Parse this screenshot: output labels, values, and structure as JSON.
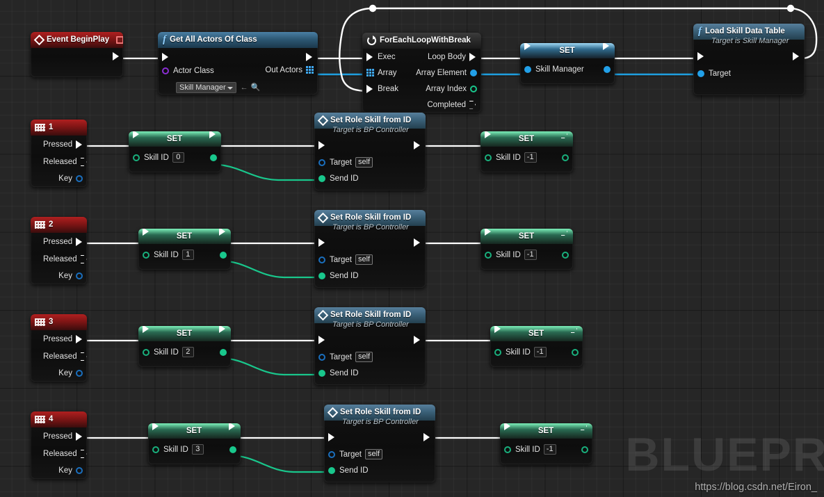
{
  "graph": {
    "title": "Blueprint Event Graph",
    "background_color": "#262626",
    "watermark": "BLUEPR",
    "url": "https://blog.csdn.net/Eiron_"
  },
  "nodes": {
    "event_begin_play": {
      "title": "Event BeginPlay",
      "icon": "event-diamond-icon",
      "badge": "delegate-square-icon"
    },
    "get_all_actors": {
      "title": "Get All Actors Of Class",
      "icon": "function-f-icon",
      "in_exec": "",
      "out_exec": "",
      "actor_class_label": "Actor Class",
      "actor_class_value": "Skill Manager",
      "out_actors_label": "Out Actors"
    },
    "foreach": {
      "title": "ForEachLoopWithBreak",
      "icon": "loop-icon",
      "exec_label": "Exec",
      "array_label": "Array",
      "break_label": "Break",
      "loop_body_label": "Loop Body",
      "array_element_label": "Array Element",
      "array_index_label": "Array Index",
      "completed_label": "Completed"
    },
    "set_skill_manager": {
      "title": "SET",
      "pin_label": "Skill Manager"
    },
    "load_skill_data_table": {
      "title": "Load Skill Data Table",
      "subtitle": "Target is Skill Manager",
      "icon": "function-f-icon",
      "target_label": "Target"
    }
  },
  "rows": [
    {
      "key_event": {
        "title": "1",
        "icon": "keyboard-icon",
        "pressed": "Pressed",
        "released": "Released",
        "key": "Key"
      },
      "set_left": {
        "title": "SET",
        "pin_label": "Skill ID",
        "value": "0"
      },
      "action": {
        "title": "Set Role Skill from ID",
        "subtitle": "Target is BP Controller",
        "icon": "event-diamond-icon",
        "target_label": "Target",
        "target_value": "self",
        "send_id_label": "Send ID"
      },
      "set_right": {
        "title": "SET",
        "pin_label": "Skill ID",
        "value": "-1"
      }
    },
    {
      "key_event": {
        "title": "2",
        "icon": "keyboard-icon",
        "pressed": "Pressed",
        "released": "Released",
        "key": "Key"
      },
      "set_left": {
        "title": "SET",
        "pin_label": "Skill ID",
        "value": "1"
      },
      "action": {
        "title": "Set Role Skill from ID",
        "subtitle": "Target is BP Controller",
        "icon": "event-diamond-icon",
        "target_label": "Target",
        "target_value": "self",
        "send_id_label": "Send ID"
      },
      "set_right": {
        "title": "SET",
        "pin_label": "Skill ID",
        "value": "-1"
      }
    },
    {
      "key_event": {
        "title": "3",
        "icon": "keyboard-icon",
        "pressed": "Pressed",
        "released": "Released",
        "key": "Key"
      },
      "set_left": {
        "title": "SET",
        "pin_label": "Skill ID",
        "value": "2"
      },
      "action": {
        "title": "Set Role Skill from ID",
        "subtitle": "Target is BP Controller",
        "icon": "event-diamond-icon",
        "target_label": "Target",
        "target_value": "self",
        "send_id_label": "Send ID"
      },
      "set_right": {
        "title": "SET",
        "pin_label": "Skill ID",
        "value": "-1"
      }
    },
    {
      "key_event": {
        "title": "4",
        "icon": "keyboard-icon",
        "pressed": "Pressed",
        "released": "Released",
        "key": "Key"
      },
      "set_left": {
        "title": "SET",
        "pin_label": "Skill ID",
        "value": "3"
      },
      "action": {
        "title": "Set Role Skill from ID",
        "subtitle": "Target is BP Controller",
        "icon": "event-diamond-icon",
        "target_label": "Target",
        "target_value": "self",
        "send_id_label": "Send ID"
      },
      "set_right": {
        "title": "SET",
        "pin_label": "Skill ID",
        "value": "-1"
      }
    }
  ],
  "colors": {
    "exec_wire": "#ffffff",
    "object_wire": "#1e9fe0",
    "int_wire": "#19c78c",
    "event_header": "#7d1515",
    "function_header": "#2d5874",
    "set_header": "#2a6b52"
  }
}
